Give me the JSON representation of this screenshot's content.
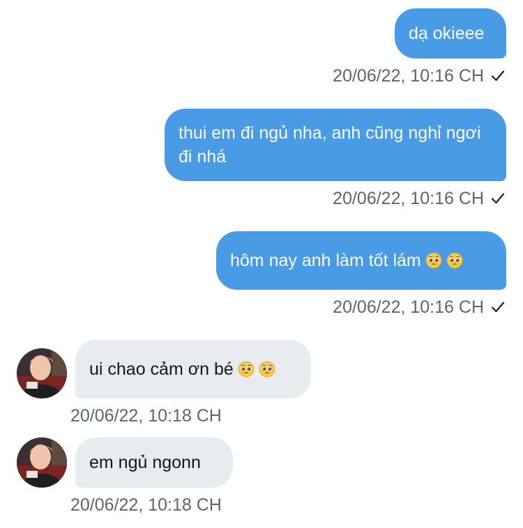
{
  "messages": [
    {
      "text": "dạ okieee",
      "time": "20/06/22, 10:16 CH"
    },
    {
      "text": "thui em đi ngủ nha, anh cũng nghỉ ngơi đi nhá",
      "time": "20/06/22, 10:16 CH"
    },
    {
      "text": "hôm nay anh làm tốt lám",
      "time": "20/06/22, 10:16 CH"
    },
    {
      "text": "ui chao cảm ơn bé",
      "time": "20/06/22, 10:18 CH"
    },
    {
      "text": "em ngủ ngonn",
      "time": "20/06/22, 10:18 CH"
    }
  ],
  "icons": {
    "read_receipt": "checkmark-icon",
    "emoji": "pleading-face-emoji"
  },
  "colors": {
    "sent_bubble": "#4a9be6",
    "received_bubble": "#e9ecef",
    "timestamp": "#5b6672"
  }
}
